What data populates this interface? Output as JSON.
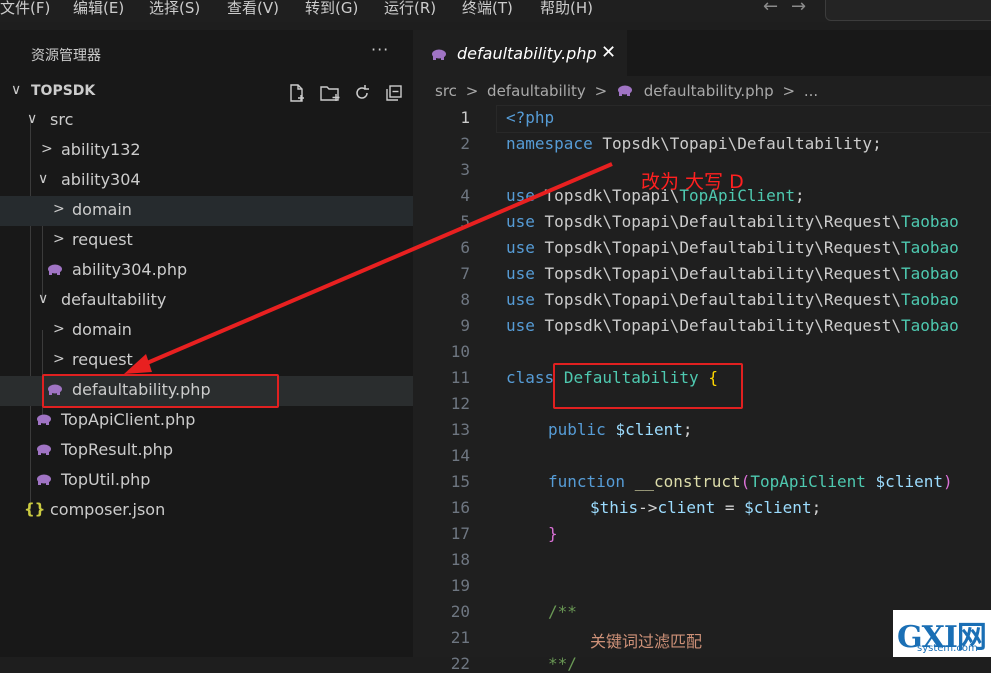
{
  "menu": [
    "文件(F)",
    "编辑(E)",
    "选择(S)",
    "查看(V)",
    "转到(G)",
    "运行(R)",
    "终端(T)",
    "帮助(H)"
  ],
  "explorer": {
    "title": "资源管理器",
    "more": "···",
    "root": "TOPSDK",
    "tree": [
      {
        "label": "src",
        "kind": "folder-open"
      },
      {
        "label": "ability132",
        "kind": "folder"
      },
      {
        "label": "ability304",
        "kind": "folder-open"
      },
      {
        "label": "domain",
        "kind": "folder"
      },
      {
        "label": "request",
        "kind": "folder"
      },
      {
        "label": "ability304.php",
        "kind": "php"
      },
      {
        "label": "defaultability",
        "kind": "folder-open"
      },
      {
        "label": "domain",
        "kind": "folder"
      },
      {
        "label": "request",
        "kind": "folder"
      },
      {
        "label": "defaultability.php",
        "kind": "php"
      },
      {
        "label": "TopApiClient.php",
        "kind": "php"
      },
      {
        "label": "TopResult.php",
        "kind": "php"
      },
      {
        "label": "TopUtil.php",
        "kind": "php"
      },
      {
        "label": "composer.json",
        "kind": "json"
      }
    ]
  },
  "tab": {
    "label": "defaultability.php",
    "close": "✕"
  },
  "breadcrumb": [
    "src",
    "defaultability",
    "defaultability.php",
    "..."
  ],
  "code": {
    "line_numbers": [
      "1",
      "2",
      "3",
      "4",
      "5",
      "6",
      "7",
      "8",
      "9",
      "10",
      "11",
      "12",
      "13",
      "14",
      "15",
      "16",
      "17",
      "18",
      "19",
      "20",
      "21",
      "22"
    ],
    "l1": "<?php",
    "l2_kw": "namespace",
    "l2_ns": "Topsdk\\Topapi\\Defaultability;",
    "l4_kw": "use",
    "l4_ns": "Topsdk\\Topapi\\",
    "l4_cls": "TopApiClient",
    "l4_end": ";",
    "use_kw": "use",
    "use_ns": "Topsdk\\Topapi\\Defaultability\\Request\\",
    "use_cls": "Taobao",
    "l11_kw": "class",
    "l11_cls": "Defaultability",
    "l11_br": "{",
    "l13_kw": "public",
    "l13_var": "$client",
    "l13_end": ";",
    "l15_kw": "function",
    "l15_fn": "__construct",
    "l15_p1": "(",
    "l15_cls": "TopApiClient",
    "l15_var": "$client",
    "l15_p2": ")",
    "l16_var1": "$this",
    "l16_op": "->",
    "l16_prop": "client",
    "l16_eq": " = ",
    "l16_var2": "$client",
    "l16_end": ";",
    "l17_br": "}",
    "l20_cm": "/**",
    "l21_cm": "关键词过滤匹配",
    "l22_cm": "**/"
  },
  "annotation": {
    "text": "改为 大写 D",
    "color": "#ff2020"
  },
  "watermark": {
    "main": "GXI网",
    "sub": "system.com"
  }
}
